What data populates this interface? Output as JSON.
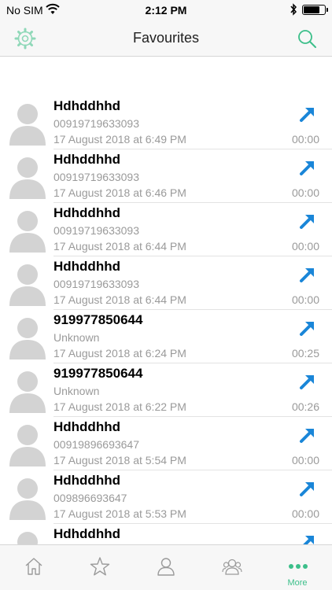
{
  "status_bar": {
    "carrier": "No SIM",
    "time": "2:12 PM",
    "battery_level": 0.8
  },
  "nav": {
    "title": "Favourites",
    "left_icon": "gear-icon",
    "right_icon": "search-icon",
    "accent_color": "#3cbf8a"
  },
  "calls": [
    {
      "name": "Hdhddhhd",
      "number": "00919719633093",
      "datetime": "17 August 2018 at 6:49 PM",
      "duration": "00:00"
    },
    {
      "name": "Hdhddhhd",
      "number": "00919719633093",
      "datetime": "17 August 2018 at 6:46 PM",
      "duration": "00:00"
    },
    {
      "name": "Hdhddhhd",
      "number": "00919719633093",
      "datetime": "17 August 2018 at 6:44 PM",
      "duration": "00:00"
    },
    {
      "name": "Hdhddhhd",
      "number": "00919719633093",
      "datetime": "17 August 2018 at 6:44 PM",
      "duration": "00:00"
    },
    {
      "name": "919977850644",
      "number": "Unknown",
      "datetime": "17 August 2018 at 6:24 PM",
      "duration": "00:25"
    },
    {
      "name": "919977850644",
      "number": "Unknown",
      "datetime": "17 August 2018 at 6:22 PM",
      "duration": "00:26"
    },
    {
      "name": "Hdhddhhd",
      "number": "00919896693647",
      "datetime": "17 August 2018 at 5:54 PM",
      "duration": "00:00"
    },
    {
      "name": "Hdhddhhd",
      "number": "009896693647",
      "datetime": "17 August 2018 at 5:53 PM",
      "duration": "00:00"
    },
    {
      "name": "Hdhddhhd",
      "number": "",
      "datetime": "",
      "duration": ""
    }
  ],
  "call_icon_color": "#1a86d8",
  "tab_bar": {
    "tabs": [
      {
        "icon": "home-icon",
        "label": ""
      },
      {
        "icon": "star-icon",
        "label": ""
      },
      {
        "icon": "contact-icon",
        "label": ""
      },
      {
        "icon": "group-icon",
        "label": ""
      },
      {
        "icon": "more-icon",
        "label": "More"
      }
    ],
    "active_tab": "More"
  }
}
